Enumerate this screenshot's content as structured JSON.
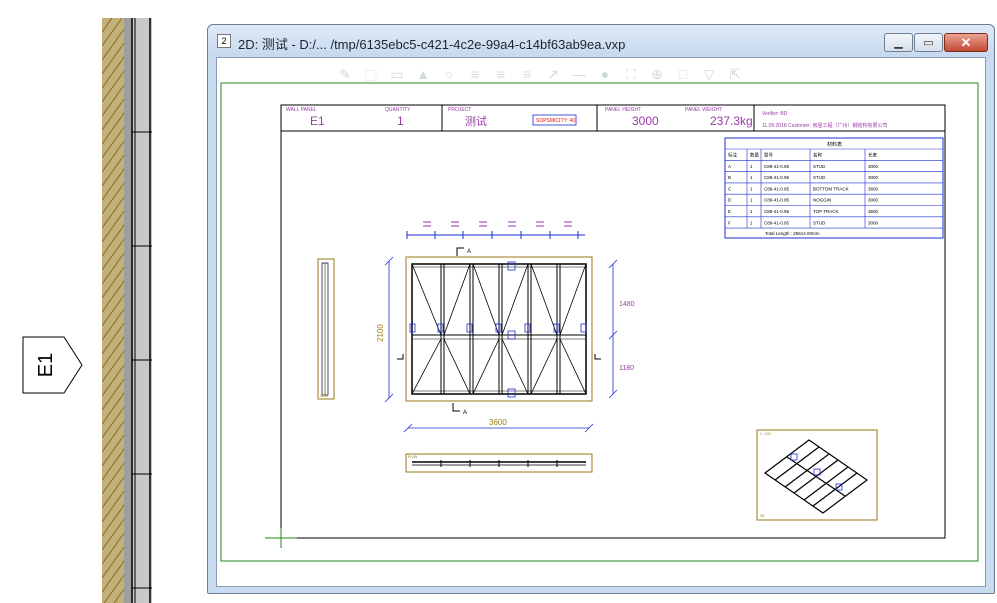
{
  "window": {
    "title": "2D: 测试 - D:/... /tmp/6135ebc5-c421-4c2e-99a4-c14bf63ab9ea.vxp",
    "app_icon": "document-2d-icon",
    "minimize_icon": "minimize-icon",
    "maximize_icon": "maximize-icon",
    "close_icon": "close-icon"
  },
  "section_tag": {
    "label": "E1"
  },
  "header": {
    "wall_panel_label": "WALL PANEL",
    "wall_panel_value": "E1",
    "quantity_label": "QUANTITY",
    "quantity_value": "1",
    "project_label": "PROJECT",
    "project_value": "测试",
    "seismicity": "SOPSMICITY: 40",
    "panel_height_label": "PANEL HEIGHT",
    "panel_height_value": "3000",
    "panel_weight_label": "PANEL WEIGHT",
    "panel_weight_value": "237.3kg",
    "verified_by": "Verifier: BD",
    "date_customer": "11.09.2018  Customer: 房屋工程（广州）钢结构有限公司"
  },
  "parts_table": {
    "title": "材料表",
    "columns": [
      "标注",
      "数量",
      "型号",
      "名称",
      "长度"
    ],
    "rows": [
      [
        "A",
        "1",
        "C89-41-0.95",
        "STUD",
        "3000"
      ],
      [
        "B",
        "1",
        "C89-41-0.95",
        "STUD",
        "3000"
      ],
      [
        "C",
        "1",
        "C89-41-0.95",
        "BOTTOM TRACK",
        "3600"
      ],
      [
        "D",
        "1",
        "C89-41-0.95",
        "NOGGIN",
        "3000"
      ],
      [
        "E",
        "1",
        "C89-41-0.95",
        "TOP TRACK",
        "3600"
      ],
      [
        "F",
        "1",
        "C89-41-0.95",
        "STUD",
        "3000"
      ]
    ],
    "total": "Total Length : 25614.00mm"
  },
  "dimensions": {
    "width": "3600",
    "height": "2100",
    "upper_segment": "1480",
    "lower_segment": "1180",
    "section_mark": "A"
  },
  "view_labels": {
    "side_view": "SIDE",
    "plan_view": "PLAN",
    "iso_scale": "1 : 100",
    "iso_view": "3D"
  },
  "colors": {
    "frame_green": "#1f8a1f",
    "dimension_blue": "#1a2fd6",
    "annotation_purple": "#9a3aa8",
    "view_border_gold": "#9a7a1a",
    "table_blue": "#1a2fd6"
  }
}
